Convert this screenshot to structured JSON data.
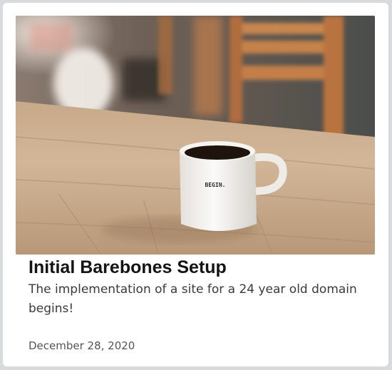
{
  "post": {
    "image": {
      "mug_text": "BEGIN."
    },
    "title": "Initial Barebones Setup",
    "excerpt": "The implementation of a site for a 24 year old domain begins!",
    "date": "December 28, 2020"
  }
}
